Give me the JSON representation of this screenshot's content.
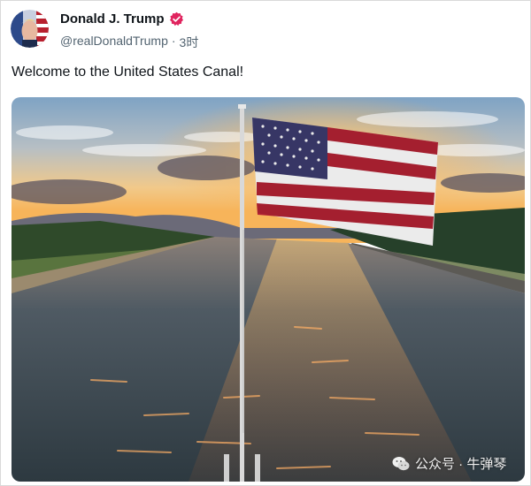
{
  "author": {
    "display_name": "Donald J. Trump",
    "handle": "@realDonaldTrump",
    "separator": "·",
    "time_ago": "3时",
    "verified_color": "#e0245e"
  },
  "post": {
    "text": "Welcome to the United States Canal!"
  },
  "media": {
    "description_icon": "flag-over-canal-photo"
  },
  "watermark": {
    "text": "公众号 · 牛弹琴",
    "icon": "wechat-icon"
  }
}
